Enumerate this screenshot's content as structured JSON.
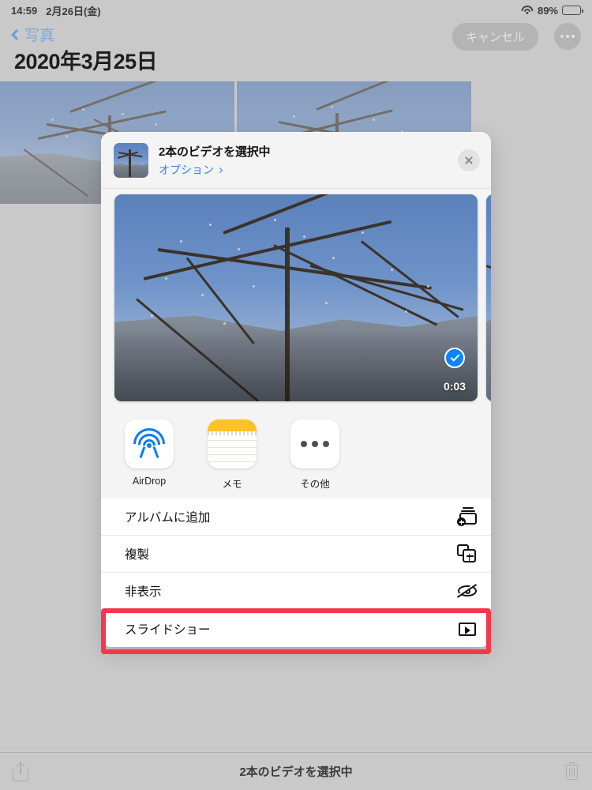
{
  "status_bar": {
    "time": "14:59",
    "date": "2月26日(金)",
    "wifi_icon": "wifi-icon",
    "battery_percent": "89%",
    "battery_icon": "battery-icon"
  },
  "nav_bar": {
    "back_label": "写真",
    "back_icon": "chevron-left-icon",
    "page_title": "2020年3月25日",
    "cancel_label": "キャンセル",
    "more_icon": "ellipsis-icon"
  },
  "share_sheet": {
    "header": {
      "title": "2本のビデオを選択中",
      "options_label": "オプション",
      "options_chevron_icon": "chevron-right-icon",
      "thumbnail_icon": "video-thumbnail",
      "close_icon": "close-icon"
    },
    "preview": {
      "duration": "0:03",
      "selected_icon": "checkmark-circle-icon",
      "accent_color": "#0a84ff"
    },
    "apps": [
      {
        "label": "AirDrop",
        "icon": "airdrop-icon"
      },
      {
        "label": "メモ",
        "icon": "notes-icon"
      },
      {
        "label": "その他",
        "icon": "more-icon"
      }
    ],
    "actions": [
      {
        "label": "アルバムに追加",
        "icon": "add-to-album-icon",
        "highlighted": false
      },
      {
        "label": "複製",
        "icon": "duplicate-icon",
        "highlighted": false
      },
      {
        "label": "非表示",
        "icon": "hide-icon",
        "highlighted": false
      },
      {
        "label": "スライドショー",
        "icon": "slideshow-icon",
        "highlighted": true
      }
    ],
    "highlight_color": "#f5364c"
  },
  "bottom_bar": {
    "share_icon": "share-icon",
    "label": "2本のビデオを選択中",
    "trash_icon": "trash-icon"
  }
}
